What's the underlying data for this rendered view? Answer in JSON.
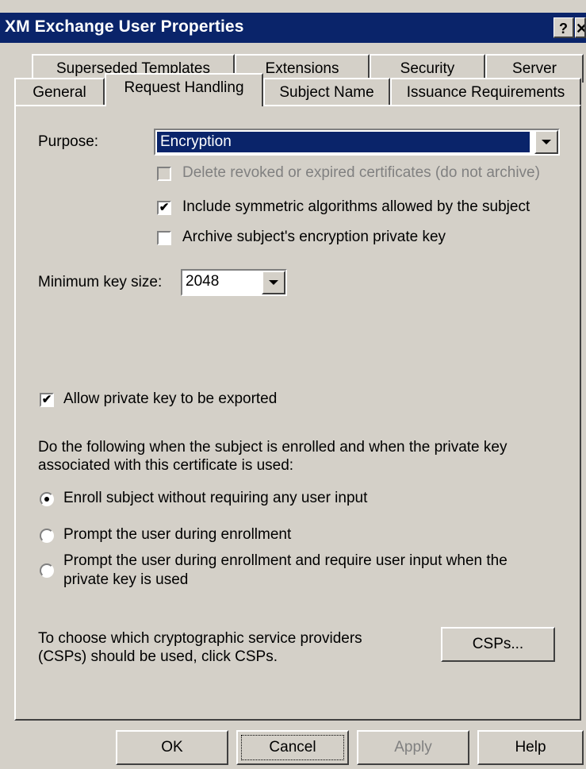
{
  "window": {
    "title": "XM Exchange User Properties",
    "help_button": "?",
    "close_button": "✕"
  },
  "tabs": {
    "row_top": [
      "Superseded Templates",
      "Extensions",
      "Security",
      "Server"
    ],
    "row_bottom": [
      "General",
      "Request Handling",
      "Subject Name",
      "Issuance Requirements"
    ],
    "active": "Request Handling"
  },
  "request_handling": {
    "purpose_label": "Purpose:",
    "purpose_value": "Encryption",
    "delete_revoked_label": "Delete revoked or expired certificates (do not archive)",
    "delete_revoked_checked": false,
    "include_symmetric_label": "Include symmetric algorithms allowed by the subject",
    "include_symmetric_checked": true,
    "archive_key_label": "Archive subject's encryption private key",
    "archive_key_checked": false,
    "min_key_size_label": "Minimum key size:",
    "min_key_size_value": "2048",
    "allow_export_label": "Allow private key to be exported",
    "allow_export_checked": true,
    "enroll_instructions_line1": "Do the following when the subject is enrolled and when the private key",
    "enroll_instructions_line2": "associated with this certificate is used:",
    "radio_options": [
      "Enroll subject without requiring any user input",
      "Prompt the user during enrollment",
      "Prompt the user during enrollment and require user input when the",
      "private key is used"
    ],
    "selected_radio": 0,
    "csp_text_line1": "To choose which cryptographic service providers",
    "csp_text_line2": "(CSPs) should be used, click CSPs.",
    "csp_button": "CSPs..."
  },
  "footer": {
    "ok": "OK",
    "cancel": "Cancel",
    "apply": "Apply",
    "help": "Help"
  }
}
